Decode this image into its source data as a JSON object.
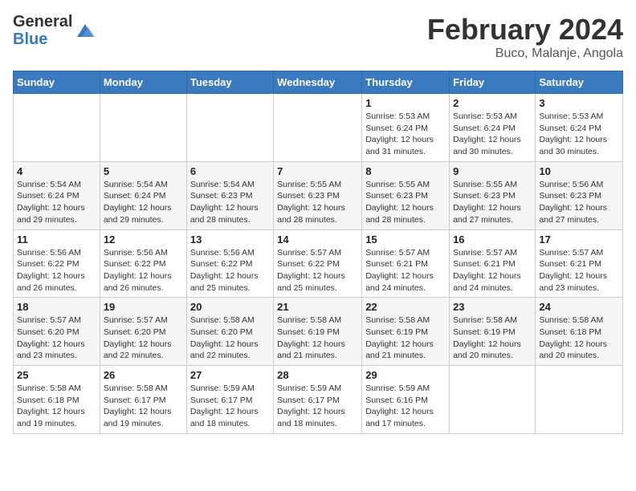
{
  "logo": {
    "general": "General",
    "blue": "Blue"
  },
  "title": {
    "month_year": "February 2024",
    "location": "Buco, Malanje, Angola"
  },
  "days_of_week": [
    "Sunday",
    "Monday",
    "Tuesday",
    "Wednesday",
    "Thursday",
    "Friday",
    "Saturday"
  ],
  "weeks": [
    [
      {
        "day": "",
        "info": ""
      },
      {
        "day": "",
        "info": ""
      },
      {
        "day": "",
        "info": ""
      },
      {
        "day": "",
        "info": ""
      },
      {
        "day": "1",
        "info": "Sunrise: 5:53 AM\nSunset: 6:24 PM\nDaylight: 12 hours and 31 minutes."
      },
      {
        "day": "2",
        "info": "Sunrise: 5:53 AM\nSunset: 6:24 PM\nDaylight: 12 hours and 30 minutes."
      },
      {
        "day": "3",
        "info": "Sunrise: 5:53 AM\nSunset: 6:24 PM\nDaylight: 12 hours and 30 minutes."
      }
    ],
    [
      {
        "day": "4",
        "info": "Sunrise: 5:54 AM\nSunset: 6:24 PM\nDaylight: 12 hours and 29 minutes."
      },
      {
        "day": "5",
        "info": "Sunrise: 5:54 AM\nSunset: 6:24 PM\nDaylight: 12 hours and 29 minutes."
      },
      {
        "day": "6",
        "info": "Sunrise: 5:54 AM\nSunset: 6:23 PM\nDaylight: 12 hours and 28 minutes."
      },
      {
        "day": "7",
        "info": "Sunrise: 5:55 AM\nSunset: 6:23 PM\nDaylight: 12 hours and 28 minutes."
      },
      {
        "day": "8",
        "info": "Sunrise: 5:55 AM\nSunset: 6:23 PM\nDaylight: 12 hours and 28 minutes."
      },
      {
        "day": "9",
        "info": "Sunrise: 5:55 AM\nSunset: 6:23 PM\nDaylight: 12 hours and 27 minutes."
      },
      {
        "day": "10",
        "info": "Sunrise: 5:56 AM\nSunset: 6:23 PM\nDaylight: 12 hours and 27 minutes."
      }
    ],
    [
      {
        "day": "11",
        "info": "Sunrise: 5:56 AM\nSunset: 6:22 PM\nDaylight: 12 hours and 26 minutes."
      },
      {
        "day": "12",
        "info": "Sunrise: 5:56 AM\nSunset: 6:22 PM\nDaylight: 12 hours and 26 minutes."
      },
      {
        "day": "13",
        "info": "Sunrise: 5:56 AM\nSunset: 6:22 PM\nDaylight: 12 hours and 25 minutes."
      },
      {
        "day": "14",
        "info": "Sunrise: 5:57 AM\nSunset: 6:22 PM\nDaylight: 12 hours and 25 minutes."
      },
      {
        "day": "15",
        "info": "Sunrise: 5:57 AM\nSunset: 6:21 PM\nDaylight: 12 hours and 24 minutes."
      },
      {
        "day": "16",
        "info": "Sunrise: 5:57 AM\nSunset: 6:21 PM\nDaylight: 12 hours and 24 minutes."
      },
      {
        "day": "17",
        "info": "Sunrise: 5:57 AM\nSunset: 6:21 PM\nDaylight: 12 hours and 23 minutes."
      }
    ],
    [
      {
        "day": "18",
        "info": "Sunrise: 5:57 AM\nSunset: 6:20 PM\nDaylight: 12 hours and 23 minutes."
      },
      {
        "day": "19",
        "info": "Sunrise: 5:57 AM\nSunset: 6:20 PM\nDaylight: 12 hours and 22 minutes."
      },
      {
        "day": "20",
        "info": "Sunrise: 5:58 AM\nSunset: 6:20 PM\nDaylight: 12 hours and 22 minutes."
      },
      {
        "day": "21",
        "info": "Sunrise: 5:58 AM\nSunset: 6:19 PM\nDaylight: 12 hours and 21 minutes."
      },
      {
        "day": "22",
        "info": "Sunrise: 5:58 AM\nSunset: 6:19 PM\nDaylight: 12 hours and 21 minutes."
      },
      {
        "day": "23",
        "info": "Sunrise: 5:58 AM\nSunset: 6:19 PM\nDaylight: 12 hours and 20 minutes."
      },
      {
        "day": "24",
        "info": "Sunrise: 5:58 AM\nSunset: 6:18 PM\nDaylight: 12 hours and 20 minutes."
      }
    ],
    [
      {
        "day": "25",
        "info": "Sunrise: 5:58 AM\nSunset: 6:18 PM\nDaylight: 12 hours and 19 minutes."
      },
      {
        "day": "26",
        "info": "Sunrise: 5:58 AM\nSunset: 6:17 PM\nDaylight: 12 hours and 19 minutes."
      },
      {
        "day": "27",
        "info": "Sunrise: 5:59 AM\nSunset: 6:17 PM\nDaylight: 12 hours and 18 minutes."
      },
      {
        "day": "28",
        "info": "Sunrise: 5:59 AM\nSunset: 6:17 PM\nDaylight: 12 hours and 18 minutes."
      },
      {
        "day": "29",
        "info": "Sunrise: 5:59 AM\nSunset: 6:16 PM\nDaylight: 12 hours and 17 minutes."
      },
      {
        "day": "",
        "info": ""
      },
      {
        "day": "",
        "info": ""
      }
    ]
  ]
}
